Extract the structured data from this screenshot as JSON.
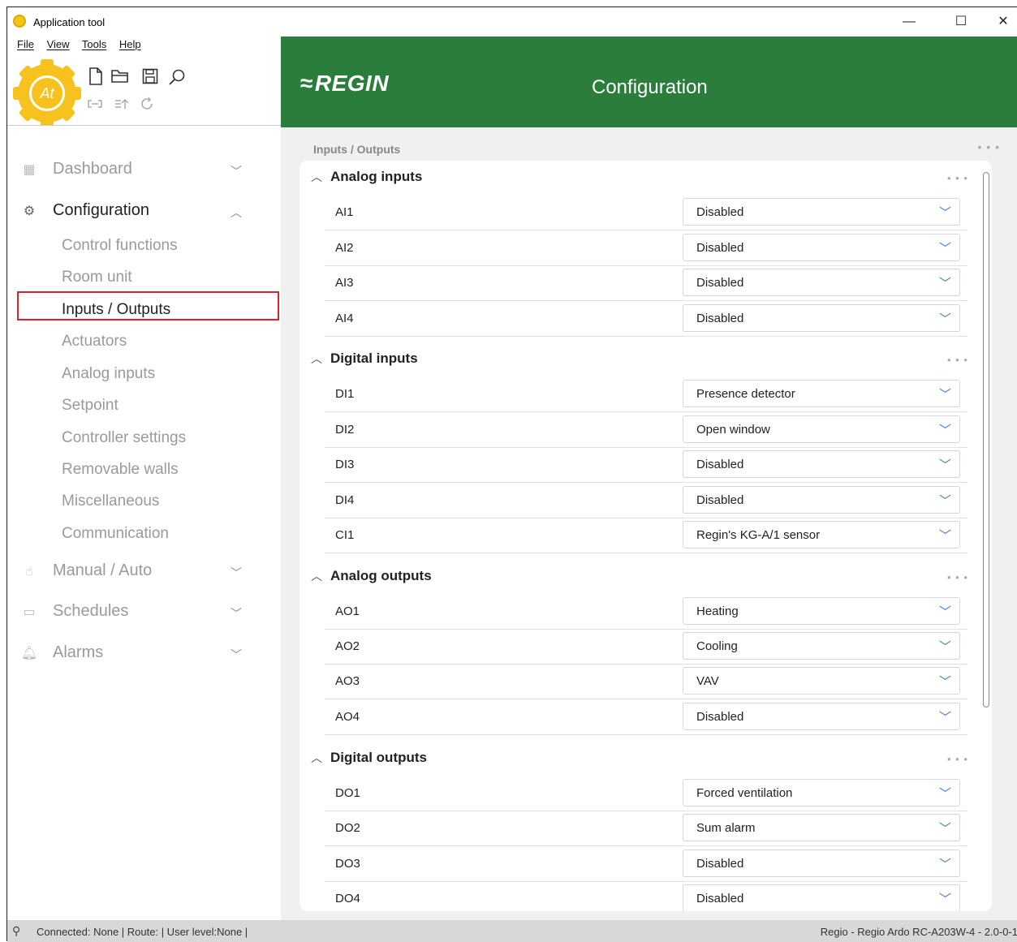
{
  "window": {
    "title": "Application tool",
    "minimize_glyph": "—",
    "maximize_glyph": "☐",
    "close_glyph": "✕"
  },
  "menu": [
    "File",
    "View",
    "Tools",
    "Help"
  ],
  "logo_text": "At",
  "sidebar": {
    "main_items": [
      {
        "label": "Dashboard",
        "icon": "dashboard-icon",
        "chevron": "﹀"
      },
      {
        "label": "Configuration",
        "icon": "gear-icon",
        "chevron": "︿"
      },
      {
        "label": "Manual / Auto",
        "icon": "hand-icon",
        "chevron": "﹀"
      },
      {
        "label": "Schedules",
        "icon": "calendar-icon",
        "chevron": "﹀"
      },
      {
        "label": "Alarms",
        "icon": "bell-icon",
        "chevron": "﹀"
      }
    ],
    "config_sub_items": [
      "Control functions",
      "Room unit",
      "Inputs / Outputs",
      "Actuators",
      "Analog inputs",
      "Setpoint",
      "Controller settings",
      "Removable walls",
      "Miscellaneous",
      "Communication"
    ],
    "selected_sub_item": "Inputs / Outputs"
  },
  "header": {
    "brand": "REGIN",
    "title": "Configuration"
  },
  "breadcrumb": "Inputs / Outputs",
  "more_glyph": "• • •",
  "sections": [
    {
      "title": "Analog inputs",
      "rows": [
        {
          "label": "AI1",
          "value": "Disabled"
        },
        {
          "label": "AI2",
          "value": "Disabled"
        },
        {
          "label": "AI3",
          "value": "Disabled"
        },
        {
          "label": "AI4",
          "value": "Disabled"
        }
      ]
    },
    {
      "title": "Digital inputs",
      "rows": [
        {
          "label": "DI1",
          "value": "Presence detector"
        },
        {
          "label": "DI2",
          "value": "Open window"
        },
        {
          "label": "DI3",
          "value": "Disabled"
        },
        {
          "label": "DI4",
          "value": "Disabled"
        },
        {
          "label": "CI1",
          "value": "Regin's KG-A/1 sensor"
        }
      ]
    },
    {
      "title": "Analog outputs",
      "rows": [
        {
          "label": "AO1",
          "value": "Heating"
        },
        {
          "label": "AO2",
          "value": "Cooling"
        },
        {
          "label": "AO3",
          "value": "VAV"
        },
        {
          "label": "AO4",
          "value": "Disabled"
        }
      ]
    },
    {
      "title": "Digital outputs",
      "rows": [
        {
          "label": "DO1",
          "value": "Forced ventilation"
        },
        {
          "label": "DO2",
          "value": "Sum alarm"
        },
        {
          "label": "DO3",
          "value": "Disabled"
        },
        {
          "label": "DO4",
          "value": "Disabled"
        }
      ]
    }
  ],
  "status": {
    "left": "Connected: None | Route: | User level:None |",
    "right": "Regio - Regio Ardo RC-A203W-4 - 2.0-0-1"
  }
}
